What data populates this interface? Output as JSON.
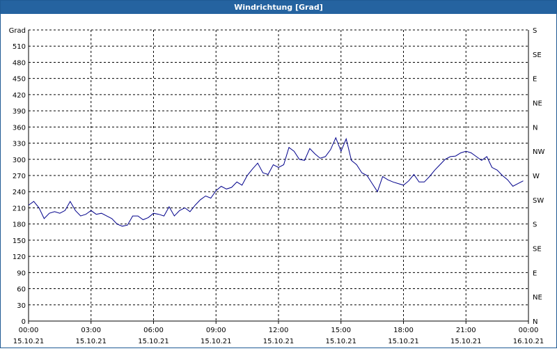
{
  "window": {
    "title": "Windrichtung [Grad]"
  },
  "chart_data": {
    "type": "line",
    "title": "Windrichtung [Grad]",
    "ylabel": "Grad",
    "ylim": [
      0,
      540
    ],
    "y_ticks": [
      0,
      30,
      60,
      90,
      120,
      150,
      180,
      210,
      240,
      270,
      300,
      330,
      360,
      390,
      420,
      450,
      480,
      510
    ],
    "right_axis_labels": [
      "N",
      "NE",
      "E",
      "SE",
      "S",
      "SW",
      "W",
      "NW",
      "N",
      "NE",
      "E",
      "SE",
      "S"
    ],
    "right_axis_values": [
      0,
      30,
      60,
      90,
      120,
      150,
      180,
      210,
      240,
      270,
      300,
      330,
      360
    ],
    "xlim": [
      0,
      24
    ],
    "x_ticks": [
      {
        "hour": 0,
        "time": "00:00",
        "date": "15.10.21"
      },
      {
        "hour": 3,
        "time": "03:00",
        "date": "15.10.21"
      },
      {
        "hour": 6,
        "time": "06:00",
        "date": "15.10.21"
      },
      {
        "hour": 9,
        "time": "09:00",
        "date": "15.10.21"
      },
      {
        "hour": 12,
        "time": "12:00",
        "date": "15.10.21"
      },
      {
        "hour": 15,
        "time": "15:00",
        "date": "15.10.21"
      },
      {
        "hour": 18,
        "time": "18:00",
        "date": "15.10.21"
      },
      {
        "hour": 21,
        "time": "21:00",
        "date": "15.10.21"
      },
      {
        "hour": 24,
        "time": "00:00",
        "date": "16.10.21"
      }
    ],
    "grid": true,
    "line_color": "#00008b",
    "series": [
      {
        "name": "",
        "x": [
          0.0,
          0.25,
          0.5,
          0.75,
          1.0,
          1.25,
          1.5,
          1.75,
          2.0,
          2.25,
          2.5,
          2.75,
          3.0,
          3.25,
          3.5,
          3.75,
          4.0,
          4.25,
          4.5,
          4.75,
          5.0,
          5.25,
          5.5,
          5.75,
          6.0,
          6.25,
          6.5,
          6.75,
          7.0,
          7.25,
          7.5,
          7.75,
          8.0,
          8.25,
          8.5,
          8.75,
          9.0,
          9.25,
          9.5,
          9.75,
          10.0,
          10.25,
          10.5,
          10.75,
          11.0,
          11.25,
          11.5,
          11.75,
          12.0,
          12.25,
          12.5,
          12.75,
          13.0,
          13.25,
          13.5,
          13.75,
          14.0,
          14.25,
          14.5,
          14.75,
          15.0,
          15.25,
          15.5,
          15.75,
          16.0,
          16.25,
          16.5,
          16.75,
          17.0,
          17.25,
          17.5,
          17.75,
          18.0,
          18.25,
          18.5,
          18.75,
          19.0,
          19.25,
          19.5,
          19.75,
          20.0,
          20.25,
          20.5,
          20.75,
          21.0,
          21.25,
          21.5,
          21.75,
          22.0,
          22.25,
          22.5,
          22.75,
          23.0,
          23.25,
          23.5,
          23.75
        ],
        "values": [
          215,
          222,
          210,
          190,
          200,
          203,
          200,
          205,
          222,
          205,
          195,
          198,
          205,
          198,
          200,
          195,
          190,
          180,
          176,
          178,
          195,
          195,
          188,
          192,
          200,
          198,
          195,
          212,
          195,
          205,
          210,
          203,
          215,
          225,
          232,
          228,
          242,
          250,
          245,
          248,
          258,
          252,
          270,
          282,
          293,
          275,
          272,
          290,
          285,
          290,
          322,
          315,
          300,
          298,
          320,
          310,
          302,
          305,
          318,
          340,
          315,
          338,
          298,
          290,
          275,
          270,
          255,
          240,
          268,
          262,
          258,
          255,
          252,
          260,
          272,
          258,
          258,
          268,
          280,
          290,
          300,
          305,
          306,
          312,
          315,
          312,
          305,
          298,
          305,
          285,
          280,
          270,
          262,
          250,
          255,
          260
        ]
      }
    ]
  }
}
